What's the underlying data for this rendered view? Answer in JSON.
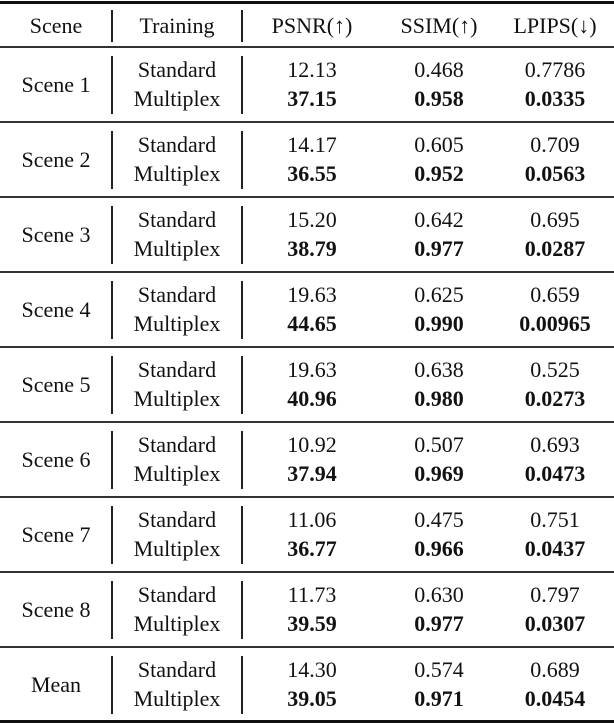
{
  "header": {
    "scene": "Scene",
    "training": "Training",
    "psnr": "PSNR(↑)",
    "ssim": "SSIM(↑)",
    "lpips": "LPIPS(↓)"
  },
  "rows": [
    {
      "scene": "Scene 1",
      "standard": {
        "label": "Standard",
        "psnr": "12.13",
        "ssim": "0.468",
        "lpips": "0.7786"
      },
      "multiplex": {
        "label": "Multiplex",
        "psnr": "37.15",
        "ssim": "0.958",
        "lpips": "0.0335"
      }
    },
    {
      "scene": "Scene 2",
      "standard": {
        "label": "Standard",
        "psnr": "14.17",
        "ssim": "0.605",
        "lpips": "0.709"
      },
      "multiplex": {
        "label": "Multiplex",
        "psnr": "36.55",
        "ssim": "0.952",
        "lpips": "0.0563"
      }
    },
    {
      "scene": "Scene 3",
      "standard": {
        "label": "Standard",
        "psnr": "15.20",
        "ssim": "0.642",
        "lpips": "0.695"
      },
      "multiplex": {
        "label": "Multiplex",
        "psnr": "38.79",
        "ssim": "0.977",
        "lpips": "0.0287"
      }
    },
    {
      "scene": "Scene 4",
      "standard": {
        "label": "Standard",
        "psnr": "19.63",
        "ssim": "0.625",
        "lpips": "0.659"
      },
      "multiplex": {
        "label": "Multiplex",
        "psnr": "44.65",
        "ssim": "0.990",
        "lpips": "0.00965"
      }
    },
    {
      "scene": "Scene 5",
      "standard": {
        "label": "Standard",
        "psnr": "19.63",
        "ssim": "0.638",
        "lpips": "0.525"
      },
      "multiplex": {
        "label": "Multiplex",
        "psnr": "40.96",
        "ssim": "0.980",
        "lpips": "0.0273"
      }
    },
    {
      "scene": "Scene 6",
      "standard": {
        "label": "Standard",
        "psnr": "10.92",
        "ssim": "0.507",
        "lpips": "0.693"
      },
      "multiplex": {
        "label": "Multiplex",
        "psnr": "37.94",
        "ssim": "0.969",
        "lpips": "0.0473"
      }
    },
    {
      "scene": "Scene 7",
      "standard": {
        "label": "Standard",
        "psnr": "11.06",
        "ssim": "0.475",
        "lpips": "0.751"
      },
      "multiplex": {
        "label": "Multiplex",
        "psnr": "36.77",
        "ssim": "0.966",
        "lpips": "0.0437"
      }
    },
    {
      "scene": "Scene 8",
      "standard": {
        "label": "Standard",
        "psnr": "11.73",
        "ssim": "0.630",
        "lpips": "0.797"
      },
      "multiplex": {
        "label": "Multiplex",
        "psnr": "39.59",
        "ssim": "0.977",
        "lpips": "0.0307"
      }
    },
    {
      "scene": "Mean",
      "standard": {
        "label": "Standard",
        "psnr": "14.30",
        "ssim": "0.574",
        "lpips": "0.689"
      },
      "multiplex": {
        "label": "Multiplex",
        "psnr": "39.05",
        "ssim": "0.971",
        "lpips": "0.0454"
      }
    }
  ]
}
